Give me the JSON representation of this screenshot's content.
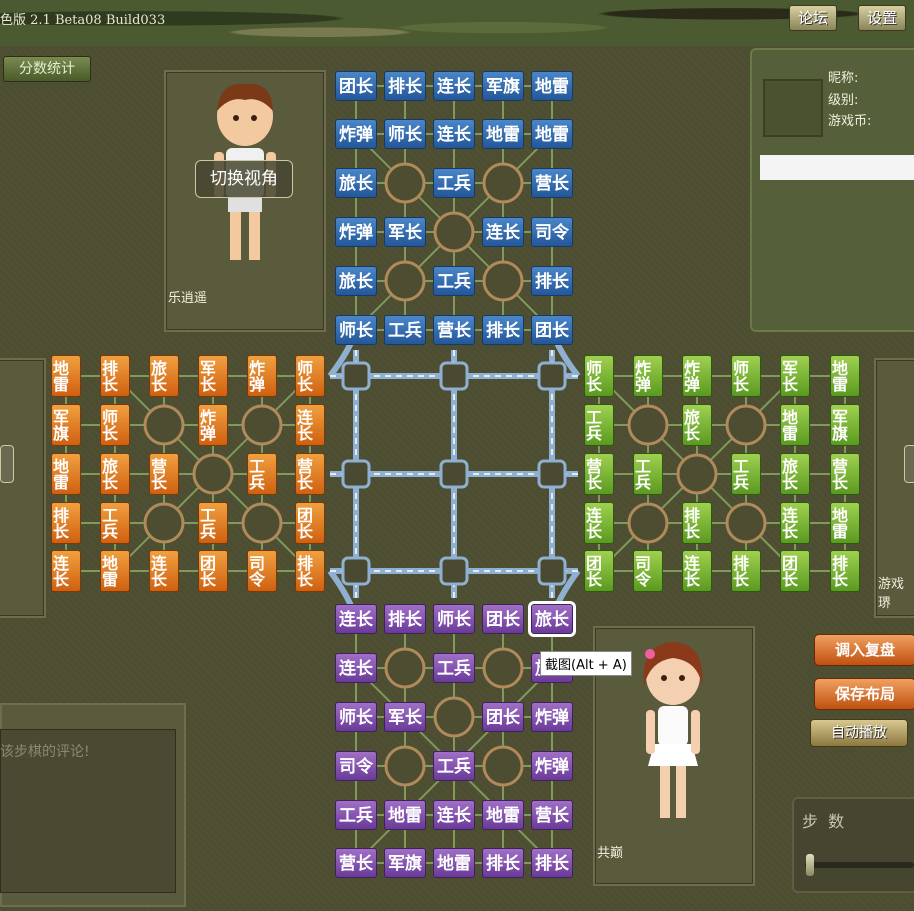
{
  "title_bar": {
    "title": "色版 2.1 Beta08 Build033",
    "forum_button": "论坛",
    "settings_button": "设置"
  },
  "score_button": "分数统计",
  "view_button": "切换视角",
  "players": {
    "top": "乐逍遥",
    "bottom": "共巅",
    "right_partial": "游戏琾"
  },
  "info": {
    "nickname_label": "昵称:",
    "level_label": "级别:",
    "coins_label": "游戏币:"
  },
  "tooltip": "截图(Alt + A)",
  "side_buttons": {
    "load_replay": "调入复盘",
    "save_layout": "保存布局",
    "auto_play": "自动播放"
  },
  "steps_label": "步  数",
  "comment_placeholder": "该步棋的评论!",
  "colors": {
    "blue": "#2f6bb0",
    "purple": "#7f4ab0",
    "orange": "#e07a1c",
    "green": "#78b838"
  },
  "pieces": {
    "blue": [
      [
        "团长",
        "排长",
        "连长",
        "军旗",
        "地雷"
      ],
      [
        "炸弹",
        "师长",
        "连长",
        "地雷",
        "地雷"
      ],
      [
        "旅长",
        "",
        "工兵",
        "",
        "营长"
      ],
      [
        "炸弹",
        "军长",
        "",
        "连长",
        "司令"
      ],
      [
        "旅长",
        "",
        "工兵",
        "",
        "排长"
      ],
      [
        "师长",
        "工兵",
        "营长",
        "排长",
        "团长"
      ]
    ],
    "purple": [
      [
        "连长",
        "排长",
        "师长",
        "团长",
        "旅长"
      ],
      [
        "连长",
        "",
        "工兵",
        "",
        "旅长"
      ],
      [
        "师长",
        "军长",
        "",
        "团长",
        "炸弹"
      ],
      [
        "司令",
        "",
        "工兵",
        "",
        "炸弹"
      ],
      [
        "工兵",
        "地雷",
        "连长",
        "地雷",
        "营长"
      ],
      [
        "营长",
        "军旗",
        "地雷",
        "排长",
        "排长"
      ]
    ],
    "orange": [
      [
        "地雷",
        "军旗",
        "地雷",
        "排长",
        "连长"
      ],
      [
        "排长",
        "师长",
        "旅长",
        "工兵",
        "地雷"
      ],
      [
        "旅长",
        "",
        "营长",
        "",
        "连长"
      ],
      [
        "军长",
        "炸弹",
        "",
        "工兵",
        "团长"
      ],
      [
        "炸弹",
        "",
        "工兵",
        "",
        "司令"
      ],
      [
        "师长",
        "连长",
        "营长",
        "团长",
        "排长"
      ]
    ],
    "green": [
      [
        "师长",
        "工兵",
        "营长",
        "连长",
        "团长"
      ],
      [
        "炸弹",
        "",
        "工兵",
        "",
        "司令"
      ],
      [
        "炸弹",
        "旅长",
        "",
        "排长",
        "连长"
      ],
      [
        "师长",
        "",
        "工兵",
        "",
        "排长"
      ],
      [
        "军长",
        "地雷",
        "旅长",
        "连长",
        "团长"
      ],
      [
        "地雷",
        "军旗",
        "营长",
        "地雷",
        "排长"
      ]
    ]
  },
  "selected_piece": "旅长"
}
